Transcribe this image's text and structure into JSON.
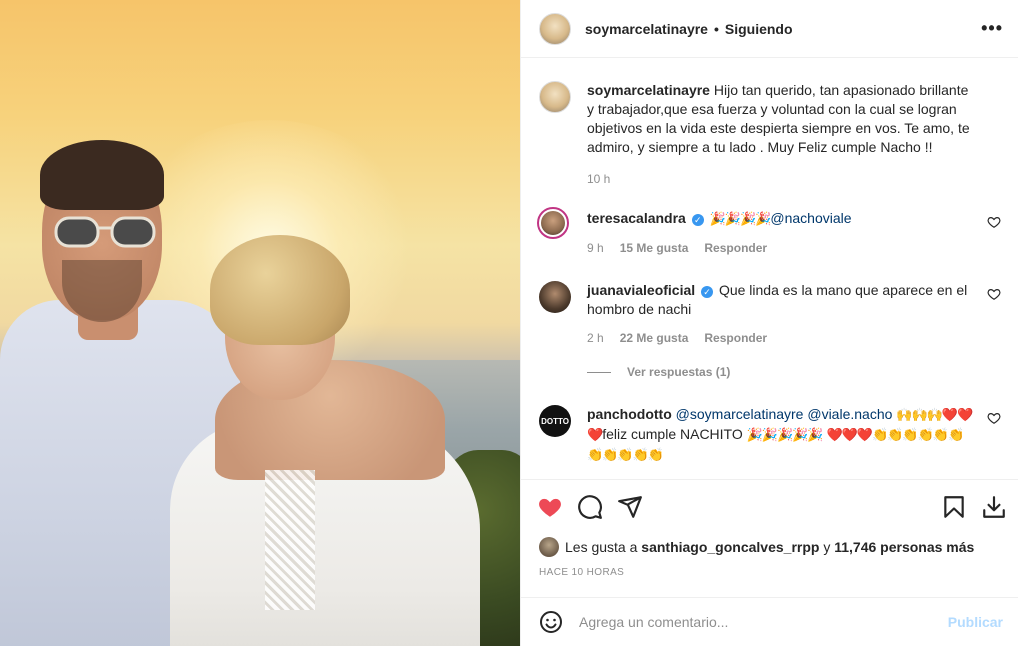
{
  "post": {
    "username": "soymarcelatinayre",
    "separator": "•",
    "follow_status": "Siguiendo",
    "more_icon": "•••",
    "photo_alt": ""
  },
  "caption": {
    "username": "soymarcelatinayre",
    "text": "Hijo tan querido, tan apasionado brillante y trabajador,que esa fuerza y voluntad con la cual se logran objetivos en la vida este despierta siempre en vos. Te amo, te admiro, y siempre a tu lado . Muy Feliz cumple Nacho !!",
    "time": "10 h"
  },
  "comments": [
    {
      "username": "teresacalandra",
      "verified": true,
      "emoji": "🎉🎉🎉🎉",
      "mention": "@nachoviale",
      "time": "9 h",
      "likes": "15 Me gusta",
      "reply": "Responder"
    },
    {
      "username": "juanavialeoficial",
      "verified": true,
      "text": "Que linda es la mano que aparece en el hombro de nachi",
      "time": "2 h",
      "likes": "22 Me gusta",
      "reply": "Responder",
      "view_replies": "Ver respuestas (1)"
    },
    {
      "username": "panchodotto",
      "avatar_text": "DOTTO",
      "mention1": "@soymarcelatinayre",
      "mention2": "@viale.nacho",
      "emoji1": "🙌🙌🙌❤️❤️❤️",
      "text1": "feliz cumple NACHITO",
      "emoji2": "🎉🎉🎉🎉🎉",
      "emoji3": "❤️❤️❤️👏👏👏👏👏👏👏👏👏👏👏"
    }
  ],
  "actions": {
    "like_icon": "heart-filled",
    "comment_icon": "comment",
    "share_icon": "paper-plane",
    "save_icon": "bookmark",
    "download_icon": "download",
    "like_color": "#ed4956"
  },
  "likes": {
    "prefix": "Les gusta a",
    "user": "santhiago_goncalves_rrpp",
    "middle": "y",
    "count": "11,746 personas más"
  },
  "timestamp": "HACE 10 HORAS",
  "add_comment": {
    "placeholder": "Agrega un comentario...",
    "post_label": "Publicar"
  }
}
